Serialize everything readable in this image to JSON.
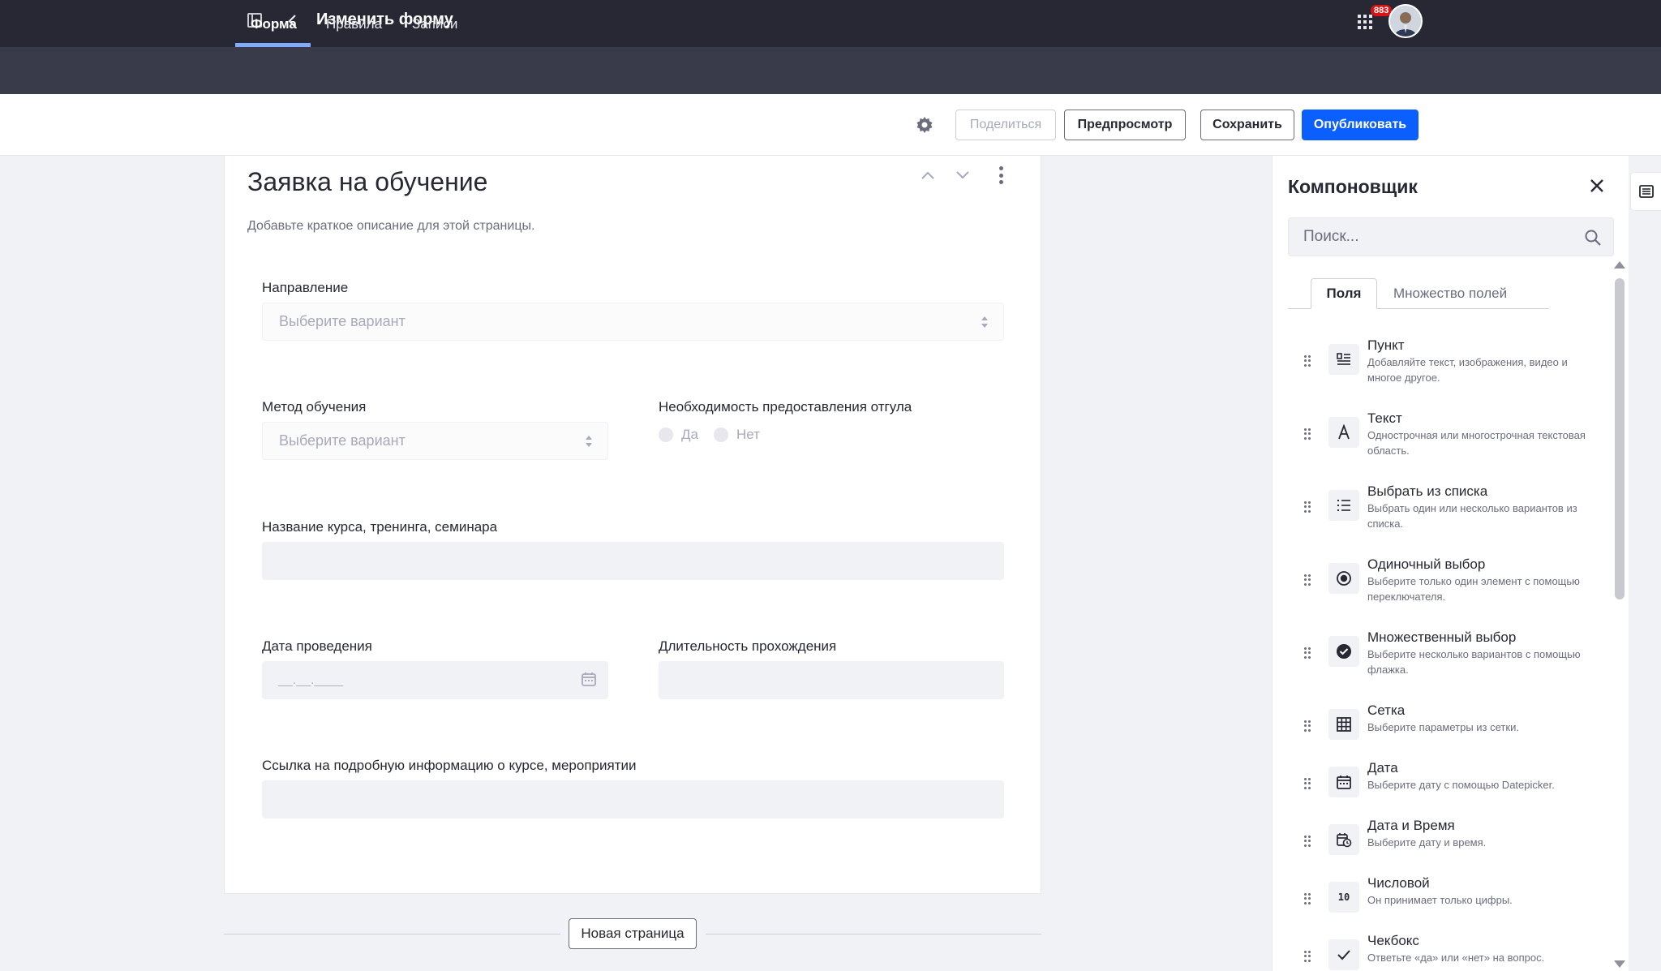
{
  "header": {
    "title": "Изменить форму",
    "notifications_count": "883"
  },
  "tabs": [
    {
      "label": "Форма",
      "active": true
    },
    {
      "label": "Правила",
      "active": false
    },
    {
      "label": "Записи",
      "active": false
    }
  ],
  "toolbar": {
    "share_label": "Поделиться",
    "preview_label": "Предпросмотр",
    "save_label": "Сохранить",
    "publish_label": "Опубликовать"
  },
  "form": {
    "title": "Заявка на обучение",
    "description": "Добавьте краткое описание для этой страницы.",
    "fields": {
      "direction": {
        "label": "Направление",
        "placeholder": "Выберите вариант"
      },
      "method": {
        "label": "Метод обучения",
        "placeholder": "Выберите вариант"
      },
      "leave": {
        "label": "Необходимость предоставления отгула",
        "options": [
          "Да",
          "Нет"
        ]
      },
      "course": {
        "label": "Название курса, тренинга, семинара",
        "value": ""
      },
      "date": {
        "label": "Дата проведения",
        "placeholder": "__.__.____"
      },
      "duration": {
        "label": "Длительность прохождения",
        "value": ""
      },
      "link": {
        "label": "Ссылка на подробную информацию о курсе, мероприятии",
        "value": ""
      }
    },
    "new_page_label": "Новая страница"
  },
  "builder": {
    "title": "Компоновщик",
    "search_placeholder": "Поиск...",
    "tabs": [
      "Поля",
      "Множество полей"
    ],
    "items": [
      {
        "icon": "paragraph-icon",
        "title": "Пункт",
        "desc": "Добавляйте текст, изображения, видео и многое другое."
      },
      {
        "icon": "text-icon",
        "title": "Текст",
        "desc": "Однострочная или многострочная текстовая область."
      },
      {
        "icon": "list-icon",
        "title": "Выбрать из списка",
        "desc": "Выбрать один или несколько вариантов из списка."
      },
      {
        "icon": "radio-icon",
        "title": "Одиночный выбор",
        "desc": "Выберите только один элемент с помощью переключателя."
      },
      {
        "icon": "checkmark-circle-icon",
        "title": "Множественный выбор",
        "desc": "Выберите несколько вариантов с помощью флажка."
      },
      {
        "icon": "grid-icon",
        "title": "Сетка",
        "desc": "Выберите параметры из сетки."
      },
      {
        "icon": "calendar-icon",
        "title": "Дата",
        "desc": "Выберите дату с помощью Datepicker."
      },
      {
        "icon": "calendar-clock-icon",
        "title": "Дата и Время",
        "desc": "Выберите дату и время."
      },
      {
        "icon": "numeric-icon",
        "title": "Числовой",
        "desc": "Он принимает только цифры.",
        "glyph": "10"
      },
      {
        "icon": "check-icon",
        "title": "Чекбокс",
        "desc": "Ответьте «да» или «нет» на вопрос."
      }
    ]
  },
  "colors": {
    "topbar": "#272833",
    "tabsbar": "#393a4a",
    "primary": "#0b5fff",
    "tab_indicator": "#80acff"
  }
}
